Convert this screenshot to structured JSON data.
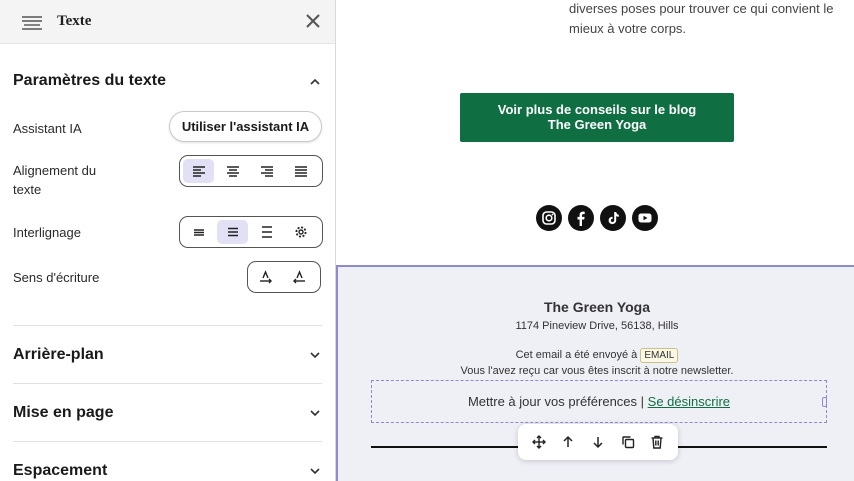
{
  "panel": {
    "title": "Texte",
    "title_icon": "text-lines-icon",
    "close_icon": "close-icon",
    "text_settings": {
      "heading": "Paramètres du texte",
      "expanded": true,
      "ai_label": "Assistant IA",
      "ai_button": "Utiliser l'assistant IA",
      "alignment_label": "Alignement du texte",
      "alignment_options": [
        "align-left-icon",
        "align-center-icon",
        "align-right-icon",
        "align-justify-icon"
      ],
      "alignment_selected": "align-left-icon",
      "line_height_label": "Interlignage",
      "line_height_options": [
        "line-height-compact-icon",
        "line-height-normal-icon",
        "line-height-loose-icon",
        "line-height-custom-gear-icon"
      ],
      "line_height_selected": "line-height-normal-icon",
      "direction_label": "Sens d'écriture",
      "direction_options": [
        "text-direction-ltr-icon",
        "text-direction-rtl-icon"
      ]
    },
    "collapsed_sections": [
      "Arrière-plan",
      "Mise en page",
      "Espacement"
    ]
  },
  "preview": {
    "top_text": "diverses poses pour trouver ce qui convient le mieux à votre corps.",
    "cta_line1": "Voir plus de conseils sur le blog",
    "cta_line2": "The Green Yoga",
    "cta_color": "#0f6f43",
    "social_icons": [
      "instagram-icon",
      "facebook-icon",
      "tiktok-icon",
      "youtube-icon"
    ],
    "footer": {
      "brand": "The Green Yoga",
      "address": "1174 Pineview Drive, 56138, Hills",
      "sent_prefix": "Cet email a été envoyé à",
      "email_tag": "EMAIL",
      "reason": "Vous l'avez reçu car vous êtes inscrit à notre newsletter.",
      "prefs_text": "Mettre à jour vos préférences |",
      "unsubscribe": "Se désinscrire",
      "selection_color": "#8e8ad0"
    },
    "block_toolbar": [
      "move-icon",
      "arrow-up-icon",
      "arrow-down-icon",
      "duplicate-icon",
      "delete-icon"
    ]
  }
}
